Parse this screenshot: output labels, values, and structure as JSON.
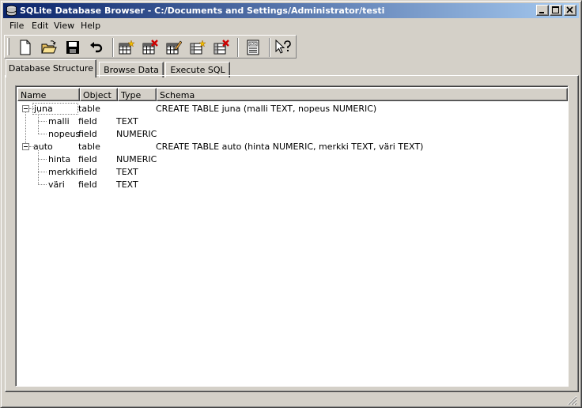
{
  "window": {
    "title": "SQLite Database Browser - C:/Documents and Settings/Administrator/testi"
  },
  "menu": {
    "items": [
      {
        "label": "File"
      },
      {
        "label": "Edit"
      },
      {
        "label": "View"
      },
      {
        "label": "Help"
      }
    ]
  },
  "toolbar": {
    "buttons": [
      {
        "icon": "new-file-icon"
      },
      {
        "icon": "open-folder-icon"
      },
      {
        "icon": "save-icon"
      },
      {
        "icon": "undo-icon"
      },
      {
        "icon": "create-table-icon"
      },
      {
        "icon": "delete-table-icon"
      },
      {
        "icon": "modify-table-icon"
      },
      {
        "icon": "create-index-icon"
      },
      {
        "icon": "delete-index-icon"
      },
      {
        "icon": "log-icon"
      },
      {
        "icon": "whats-this-icon"
      }
    ]
  },
  "tabs": [
    {
      "label": "Database Structure",
      "active": true
    },
    {
      "label": "Browse Data",
      "active": false
    },
    {
      "label": "Execute SQL",
      "active": false
    }
  ],
  "tree": {
    "columns": [
      "Name",
      "Object",
      "Type",
      "Schema"
    ],
    "rows": [
      {
        "name": "juna",
        "object": "table",
        "type": "",
        "schema": "CREATE TABLE juna (malli TEXT, nopeus NUMERIC)"
      },
      {
        "name": "malli",
        "object": "field",
        "type": "TEXT",
        "schema": ""
      },
      {
        "name": "nopeus",
        "object": "field",
        "type": "NUMERIC",
        "schema": ""
      },
      {
        "name": "auto",
        "object": "table",
        "type": "",
        "schema": "CREATE TABLE auto (hinta NUMERIC, merkki TEXT, väri TEXT)"
      },
      {
        "name": "hinta",
        "object": "field",
        "type": "NUMERIC",
        "schema": ""
      },
      {
        "name": "merkki",
        "object": "field",
        "type": "TEXT",
        "schema": ""
      },
      {
        "name": "väri",
        "object": "field",
        "type": "TEXT",
        "schema": ""
      }
    ]
  },
  "colors": {
    "title_start": "#0a246a",
    "title_end": "#a6caf0",
    "face": "#d4d0c8"
  }
}
